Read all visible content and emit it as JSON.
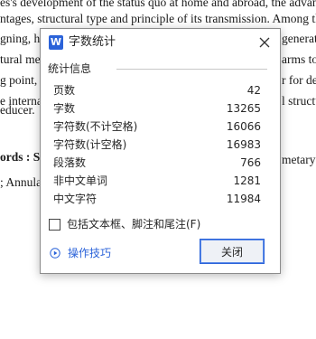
{
  "document": {
    "lines": [
      "es's development of the status quo at home and abroad, the advantages and",
      "ntages, structural type and principle of its transmission. Among the proces",
      "gning, ha",
      "tural mesh",
      "g point, c",
      "e internal",
      "educer.",
      "ords : S",
      "; Annular"
    ],
    "right_fragments": [
      "generated",
      "arms to th",
      "r for desi",
      "l structur",
      "metary gea"
    ]
  },
  "dialog": {
    "app_icon_letter": "W",
    "title": "字数统计",
    "group_label": "统计信息",
    "stats": [
      {
        "label": "页数",
        "value": "42"
      },
      {
        "label": "字数",
        "value": "13265"
      },
      {
        "label": "字符数(不计空格)",
        "value": "16066"
      },
      {
        "label": "字符数(计空格)",
        "value": "16983"
      },
      {
        "label": "段落数",
        "value": "766"
      },
      {
        "label": "非中文单词",
        "value": "1281"
      },
      {
        "label": "中文字符",
        "value": "11984"
      }
    ],
    "checkbox_label": "包括文本框、脚注和尾注(F)",
    "checkbox_checked": false,
    "tips_link": "操作技巧",
    "close_button": "关闭"
  },
  "colors": {
    "accent": "#2b63d9",
    "border": "#8c8c8c",
    "divider": "#c8c8c8"
  }
}
